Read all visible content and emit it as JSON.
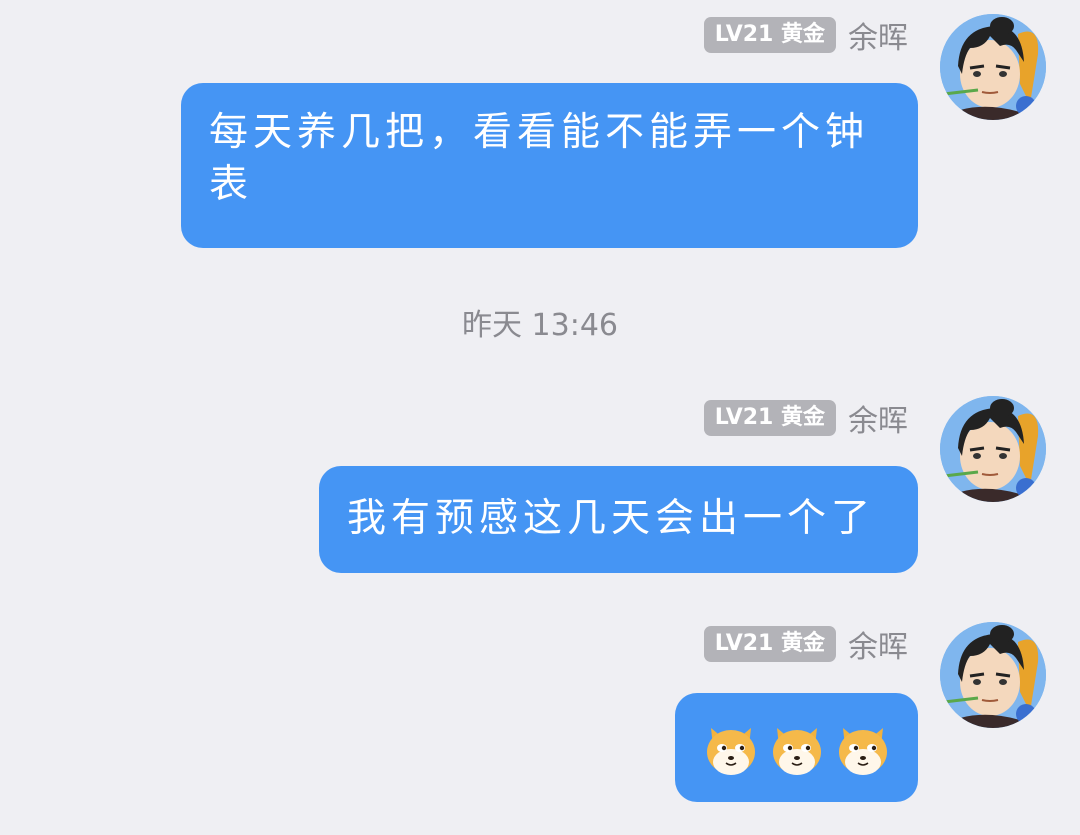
{
  "messages": [
    {
      "badge": "LV21 黄金",
      "sender": "余晖",
      "text": "每天养几把，看看能不能弄一个钟表"
    },
    {
      "badge": "LV21 黄金",
      "sender": "余晖",
      "text": "我有预感这几天会出一个了"
    },
    {
      "badge": "LV21 黄金",
      "sender": "余晖",
      "emojis": [
        "dog-face-emoji",
        "dog-face-emoji",
        "dog-face-emoji"
      ]
    }
  ],
  "timestamp": "昨天 13:46",
  "colors": {
    "background": "#efeff3",
    "bubble": "#4595f4",
    "badge": "#b3b3b8",
    "name": "#8a8a90"
  }
}
